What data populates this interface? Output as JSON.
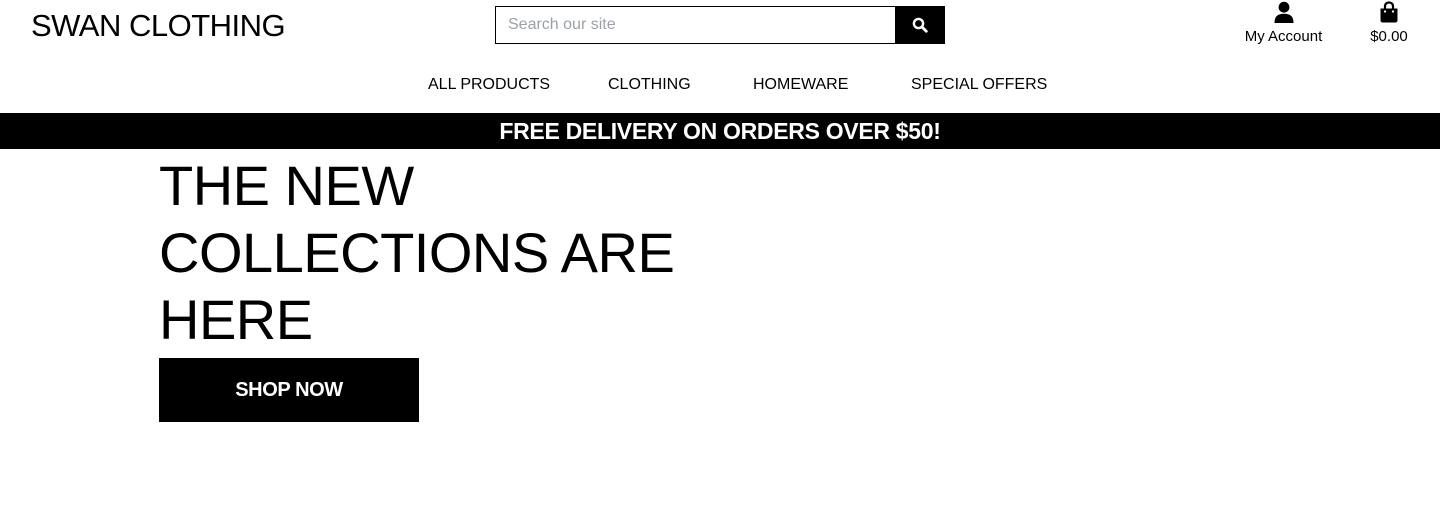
{
  "header": {
    "logo": "SWAN CLOTHING",
    "search": {
      "placeholder": "Search our site",
      "value": "",
      "icon": "search-icon"
    },
    "account": {
      "label": "My Account",
      "icon": "user-icon"
    },
    "bag": {
      "total": "$0.00",
      "icon": "shopping-bag-icon"
    }
  },
  "nav": {
    "items": [
      {
        "label": "ALL PRODUCTS"
      },
      {
        "label": "CLOTHING"
      },
      {
        "label": "HOMEWARE"
      },
      {
        "label": "SPECIAL OFFERS"
      }
    ]
  },
  "banner": {
    "text": "FREE DELIVERY ON ORDERS OVER $50!"
  },
  "hero": {
    "title": "THE NEW COLLECTIONS ARE HERE",
    "cta": "SHOP NOW"
  },
  "colors": {
    "primary": "#000000",
    "background": "#ffffff",
    "placeholder": "#9aa1a8"
  }
}
